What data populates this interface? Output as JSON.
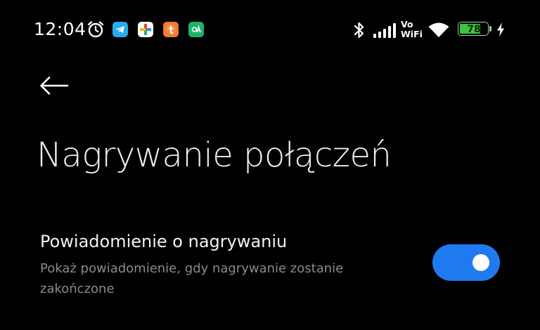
{
  "status_bar": {
    "time": "12:04",
    "icons": [
      "alarm-clock-icon",
      "telegram-icon",
      "google-workspace-icon",
      "tumblr-icon",
      "cyanogen-app-icon",
      "bluetooth-icon",
      "cellular-signal-icon",
      "vowifi-icon",
      "wifi-icon",
      "battery-icon",
      "charging-bolt-icon"
    ],
    "vowifi_line1": "Vo",
    "vowifi_line2": "WiFi",
    "battery_level": "78",
    "battery_fraction": 0.78,
    "colors": {
      "telegram": "#2AABEE",
      "tumblr": "#F47A2A",
      "green_app": "#1DB46A",
      "battery": "#3CC43C"
    }
  },
  "header": {
    "back_icon": "arrow-left-icon",
    "title": "Nagrywanie połączeń"
  },
  "settings": [
    {
      "title": "Powiadomienie o nagrywaniu",
      "description": "Pokaż powiadomienie, gdy nagrywanie zostanie zakończone",
      "enabled": true
    }
  ],
  "theme": {
    "background": "#000000",
    "accent": "#1F7AF0"
  }
}
